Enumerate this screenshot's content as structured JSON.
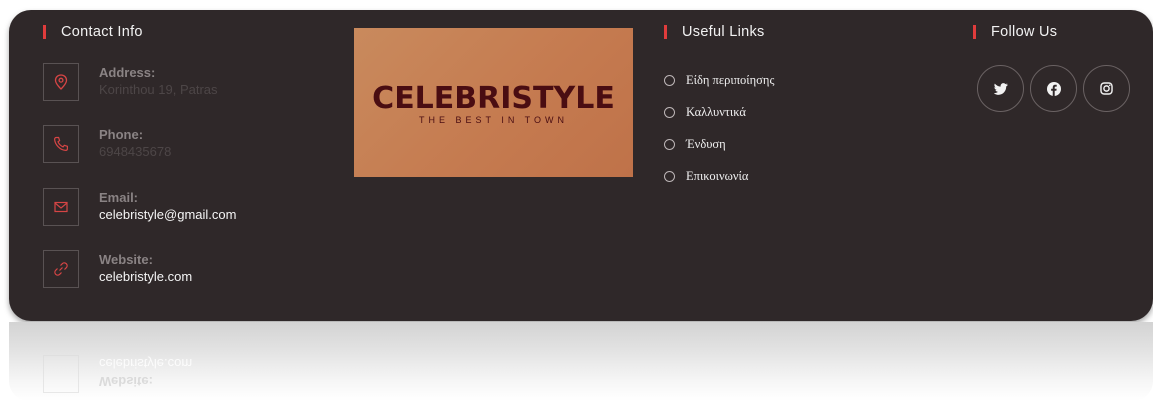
{
  "contact": {
    "title": "Contact Info",
    "items": [
      {
        "label": "Address:",
        "value": "Korinthou 19, Patras",
        "icon": "map-pin-icon"
      },
      {
        "label": "Phone:",
        "value": "6948435678",
        "icon": "phone-icon"
      },
      {
        "label": "Email:",
        "value": "celebristyle@gmail.com",
        "icon": "envelope-icon"
      },
      {
        "label": "Website:",
        "value": "celebristyle.com",
        "icon": "link-icon"
      }
    ]
  },
  "logo": {
    "name": "CELEBRISTYLE",
    "tagline": "THE BEST IN TOWN"
  },
  "links": {
    "title": "Useful Links",
    "items": [
      "Είδη περιποίησης",
      "Καλλυντικά",
      "Ένδυση",
      "Επικοινωνία"
    ]
  },
  "social": {
    "title": "Follow Us",
    "icons": [
      "twitter-icon",
      "facebook-icon",
      "instagram-icon"
    ]
  },
  "reflection": {
    "value": "celebristyle.com",
    "label": "Website:"
  },
  "colors": {
    "background": "#2f2829",
    "accent": "#e03c3c",
    "logo_bg": "#c57b50",
    "logo_text": "#4a0d12"
  }
}
